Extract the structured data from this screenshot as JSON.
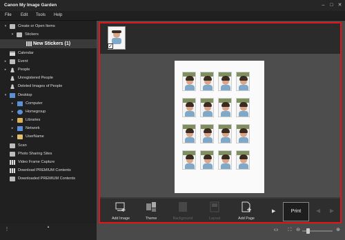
{
  "app": {
    "title": "Canon My Image Garden",
    "window_controls": [
      "minimize-icon",
      "maximize-icon",
      "close-icon"
    ]
  },
  "menu": [
    "File",
    "Edit",
    "Tools",
    "Help"
  ],
  "sidebar": {
    "items": [
      {
        "label": "Create or Open Items",
        "icon": "folder-icon",
        "expanded": true
      },
      {
        "label": "Stickers",
        "icon": "folder-icon",
        "expanded": true
      },
      {
        "label": "New Stickers (1)",
        "icon": "grid-icon",
        "selected": true
      },
      {
        "label": "Calendar",
        "icon": "calendar-icon"
      },
      {
        "label": "Event",
        "icon": "event-icon"
      },
      {
        "label": "People",
        "icon": "people-icon"
      },
      {
        "label": "Unregistered People",
        "icon": "person-icon"
      },
      {
        "label": "Deleted Images of People",
        "icon": "person-icon"
      },
      {
        "label": "Desktop",
        "icon": "desktop-icon",
        "expanded": true
      },
      {
        "label": "Computer",
        "icon": "computer-icon"
      },
      {
        "label": "Homegroup",
        "icon": "homegroup-icon"
      },
      {
        "label": "Libraries",
        "icon": "libraries-icon"
      },
      {
        "label": "Network",
        "icon": "network-icon"
      },
      {
        "label": "UserName",
        "icon": "user-folder-icon"
      },
      {
        "label": "Scan",
        "icon": "scan-icon"
      },
      {
        "label": "Photo Sharing Sites",
        "icon": "photo-sharing-icon"
      },
      {
        "label": "Video Frame Capture",
        "icon": "video-icon"
      },
      {
        "label": "Download PREMIUM Contents",
        "icon": "download-icon"
      },
      {
        "label": "Downloaded PREMIUM Contents",
        "icon": "folder-icon"
      }
    ]
  },
  "toolbar": {
    "add_image": "Add Image",
    "theme": "Theme",
    "background": "Background",
    "layout": "Layout",
    "add_page": "Add Page",
    "print": "Print"
  },
  "colors": {
    "highlight_frame": "#e3151a",
    "background": "#1a1a1a",
    "canvas": "#4d4d4d"
  }
}
